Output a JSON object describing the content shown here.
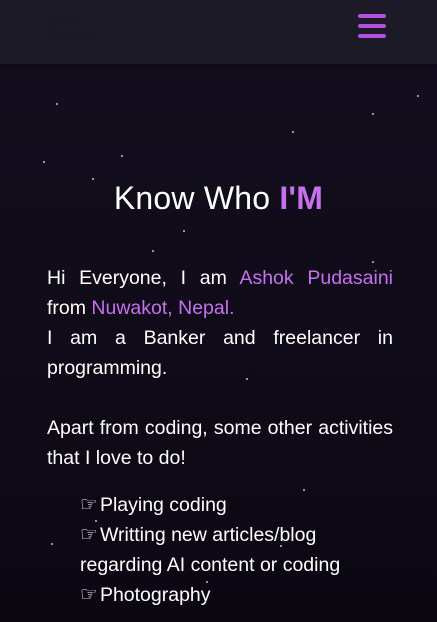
{
  "navbar": {
    "logo_line1": "Ashok",
    "logo_line2": "Pudasaini",
    "menu_icon": "hamburger-icon"
  },
  "about": {
    "title_prefix": "Know Who ",
    "title_accent": "I'M",
    "greeting": "Hi Everyone, I am ",
    "name": "Ashok Pudasaini",
    "from_text": " from ",
    "location": "Nuwakot, Nepal.",
    "profession": "I am a Banker and freelancer in programming.",
    "hobbies_intro": "Apart from coding, some other activities that I love to do!",
    "activities": [
      "Playing coding",
      "Writting new articles/blog regarding AI content or coding",
      "Photography"
    ],
    "list_icon": "hand-point-right-icon"
  },
  "colors": {
    "accent": "#c770f0",
    "menu": "#b04fe0",
    "navbar_bg": "#1b1a26",
    "page_bg": "#0f0b18"
  }
}
